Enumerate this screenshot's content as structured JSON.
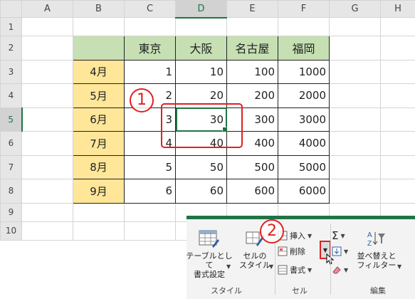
{
  "columns": [
    "A",
    "B",
    "C",
    "D",
    "E",
    "F",
    "G",
    "H"
  ],
  "rows": [
    "1",
    "2",
    "3",
    "4",
    "5",
    "6",
    "7",
    "8",
    "9",
    "10"
  ],
  "header_row": [
    "東京",
    "大阪",
    "名古屋",
    "福岡"
  ],
  "months": [
    "4月",
    "5月",
    "6月",
    "7月",
    "8月",
    "9月"
  ],
  "values": [
    [
      "1",
      "10",
      "100",
      "1000"
    ],
    [
      "2",
      "20",
      "200",
      "2000"
    ],
    [
      "3",
      "30",
      "300",
      "3000"
    ],
    [
      "4",
      "40",
      "400",
      "4000"
    ],
    [
      "5",
      "50",
      "500",
      "5000"
    ],
    [
      "6",
      "60",
      "600",
      "6000"
    ]
  ],
  "callouts": {
    "one": "1",
    "two": "2"
  },
  "ribbon": {
    "table_format": "テーブルとして\n書式設定",
    "cell_style": "セルの\nスタイル",
    "insert": "挿入",
    "delete": "削除",
    "format": "書式",
    "sort_filter": "並べ替えと\nフィルター",
    "group_style": "スタイル",
    "group_cells": "セル",
    "group_edit": "編集"
  },
  "colors": {
    "accent": "#217346",
    "header_fill": "#c6e0b4",
    "month_fill": "#ffe699",
    "annotation": "#e02020"
  }
}
